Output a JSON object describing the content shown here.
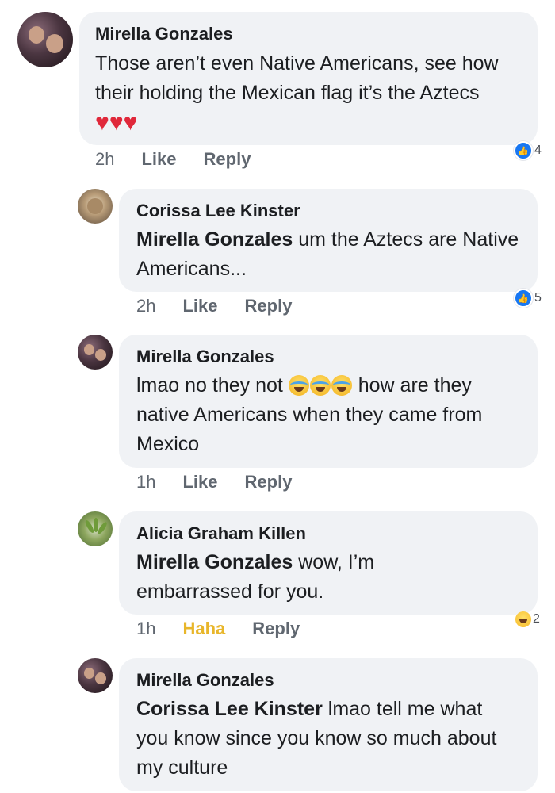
{
  "comments": [
    {
      "author": "Mirella Gonzales",
      "text_before": "Those aren’t even Native Americans, see how their holding the Mexican flag it’s the Aztecs",
      "emoji": [
        "red-heart",
        "red-heart",
        "red-heart"
      ],
      "time": "2h",
      "actions": [
        "Like",
        "Reply"
      ],
      "reaction_count": "4",
      "reaction_type": "like"
    },
    {
      "author": "Corissa Lee Kinster",
      "tag": "Mirella Gonzales",
      "text": " um the Aztecs are Native Americans...",
      "time": "2h",
      "actions": [
        "Like",
        "Reply"
      ],
      "reaction_count": "5",
      "reaction_type": "like"
    },
    {
      "author": "Mirella Gonzales",
      "text_before": "lmao no they not",
      "emoji": [
        "crying-laughing",
        "crying-laughing",
        "crying-laughing"
      ],
      "text_after": " how are they native Americans when they came from Mexico",
      "time": "1h",
      "actions": [
        "Like",
        "Reply"
      ]
    },
    {
      "author": "Alicia Graham Killen",
      "tag": "Mirella Gonzales",
      "text": " wow, I’m embarrassed for you.",
      "time": "1h",
      "actions": [
        "Haha",
        "Reply"
      ],
      "reaction_count": "2",
      "reaction_type": "haha"
    },
    {
      "author": "Mirella Gonzales",
      "tag": "Corissa Lee Kinster",
      "text": " lmao tell me what you know since you know so much about my culture"
    }
  ],
  "colors": {
    "bubble": "#f0f2f5",
    "like_blue": "#1877f2",
    "haha_yellow": "#e8b62a",
    "meta_gray": "#606770"
  }
}
